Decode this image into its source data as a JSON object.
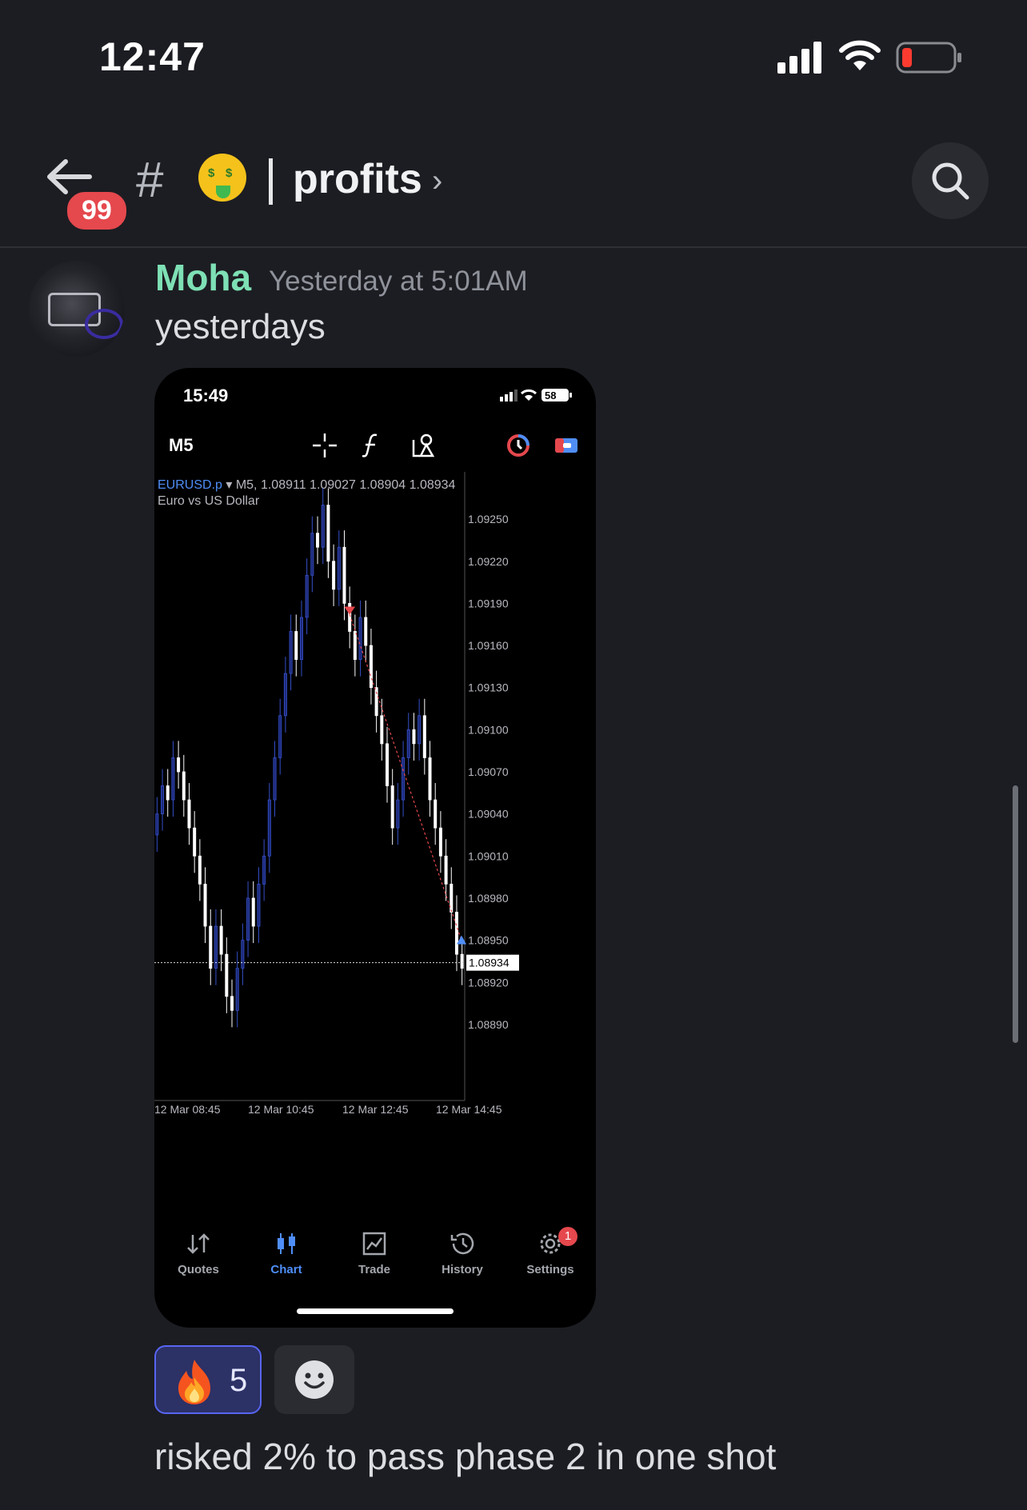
{
  "status_bar": {
    "time": "12:47"
  },
  "header": {
    "back_badge": "99",
    "hash": "#",
    "channel_name": "profits",
    "chevron": "›"
  },
  "message": {
    "author": "Moha",
    "timestamp": "Yesterday at 5:01AM",
    "text": "yesterdays",
    "followup_text": "risked 2% to pass phase 2 in one shot"
  },
  "reactions": [
    {
      "emoji": "fire",
      "count": "5"
    }
  ],
  "attachment": {
    "status_time": "15:49",
    "battery": "58",
    "timeframe": "M5",
    "symbol": "EURUSD.p",
    "ohlc_line": " ▾ M5, 1.08911 1.09027 1.08904 1.08934",
    "description": "Euro vs US Dollar",
    "price_labels": [
      "1.09250",
      "1.09220",
      "1.09190",
      "1.09160",
      "1.09130",
      "1.09100",
      "1.09070",
      "1.09040",
      "1.09010",
      "1.08980",
      "1.08950",
      "1.08920",
      "1.08890"
    ],
    "current_price": "1.08934",
    "time_labels": [
      "12 Mar 08:45",
      "12 Mar 10:45",
      "12 Mar 12:45",
      "12 Mar 14:45"
    ],
    "nav": [
      {
        "label": "Quotes"
      },
      {
        "label": "Chart"
      },
      {
        "label": "Trade"
      },
      {
        "label": "History"
      },
      {
        "label": "Settings",
        "badge": "1"
      }
    ]
  },
  "colors": {
    "author": "#7ee0b5",
    "accent": "#5865f2",
    "chart_blue": "#4f8ef7",
    "sell_arrow": "#e5484d"
  }
}
